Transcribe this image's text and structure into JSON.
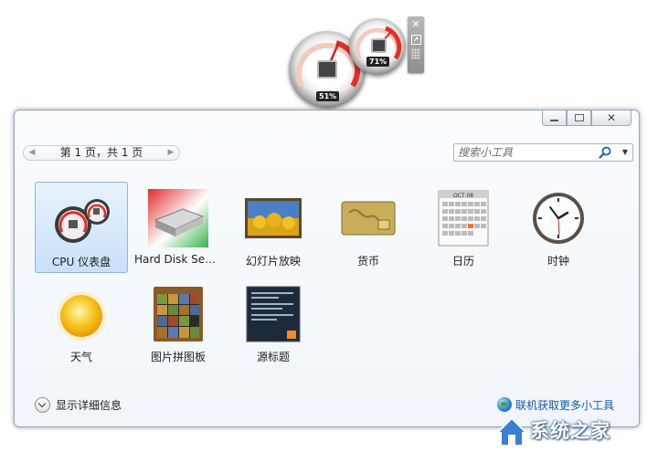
{
  "desktop_gadget": {
    "cpu_percent_label": "51%",
    "memory_percent_label": "71%",
    "cpu_usage": 51,
    "memory_usage": 71,
    "close_icon": "close-icon",
    "options_icon": "resize-icon",
    "drag_icon": "drag-grip-icon"
  },
  "window": {
    "pager": {
      "label": "第 1 页，共 1 页",
      "prev_icon": "chevron-left-icon",
      "next_icon": "chevron-right-icon"
    },
    "search": {
      "placeholder": "搜索小工具",
      "icon": "search-icon"
    },
    "gadgets": [
      {
        "label": "CPU 仪表盘",
        "icon": "cpu-meter-icon",
        "selected": true
      },
      {
        "label": "Hard Disk Sen...",
        "icon": "hard-disk-icon",
        "selected": false
      },
      {
        "label": "幻灯片放映",
        "icon": "slideshow-icon",
        "selected": false
      },
      {
        "label": "货币",
        "icon": "currency-card-icon",
        "selected": false
      },
      {
        "label": "日历",
        "icon": "calendar-icon",
        "selected": false
      },
      {
        "label": "时钟",
        "icon": "clock-icon",
        "selected": false
      },
      {
        "label": "天气",
        "icon": "weather-sun-icon",
        "selected": false
      },
      {
        "label": "图片拼图板",
        "icon": "puzzle-icon",
        "selected": false
      },
      {
        "label": "源标题",
        "icon": "feed-headlines-icon",
        "selected": false
      }
    ],
    "calendar_month": "OCT 08",
    "details_label": "显示详细信息",
    "online_label": "联机获取更多小工具"
  },
  "watermark": {
    "text": "系统之家"
  },
  "colors": {
    "accent_red": "#e0302a",
    "link_blue": "#0d5bb5",
    "selection_blue": "#c9e0f8"
  }
}
